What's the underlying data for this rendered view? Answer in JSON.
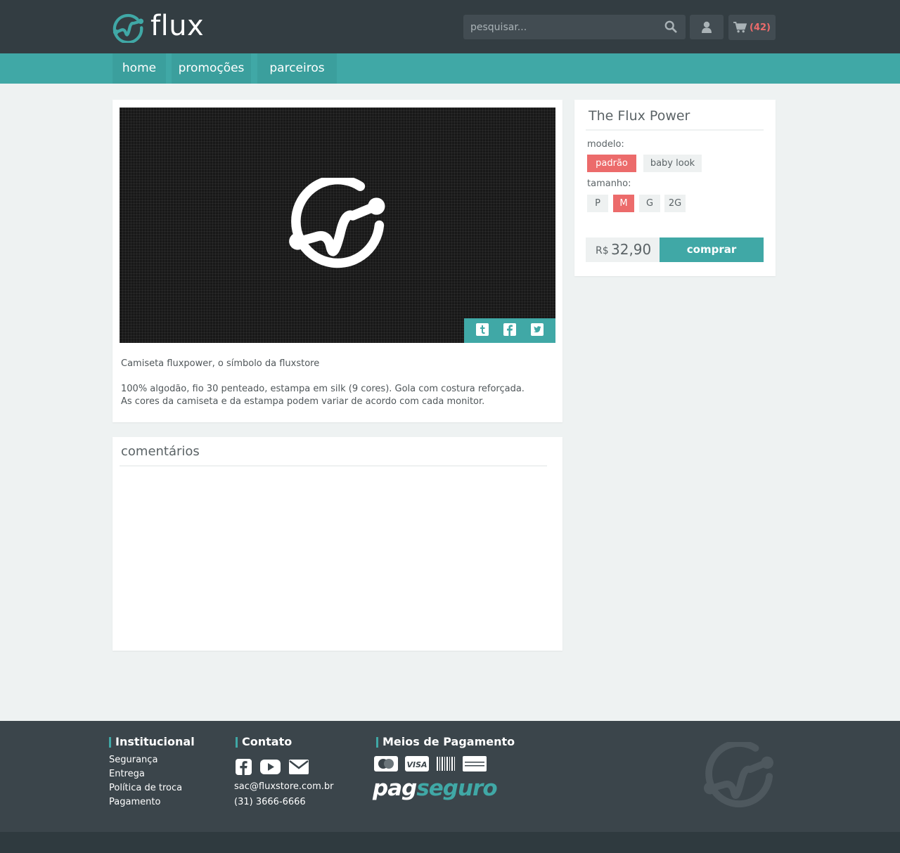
{
  "brand": {
    "name": "flux",
    "accent_color": "#40a8a6",
    "header_color": "#333d42",
    "highlight_color": "#ec6b6b"
  },
  "header": {
    "search": {
      "placeholder": "pesquisar...",
      "value": ""
    },
    "cart": {
      "count": "(42)"
    }
  },
  "nav": {
    "items": [
      {
        "label": "home"
      },
      {
        "label": "promoções"
      },
      {
        "label": "parceiros"
      }
    ]
  },
  "product": {
    "title": "The Flux Power",
    "model_label": "modelo:",
    "models": [
      {
        "label": "padrão",
        "selected": true
      },
      {
        "label": "baby look",
        "selected": false
      }
    ],
    "size_label": "tamanho:",
    "sizes": [
      {
        "label": "P",
        "selected": false
      },
      {
        "label": "M",
        "selected": true
      },
      {
        "label": "G",
        "selected": false
      },
      {
        "label": "2G",
        "selected": false
      }
    ],
    "currency": "R$",
    "price": "32,90",
    "buy_label": "comprar",
    "description": {
      "line1": "Camiseta fluxpower, o símbolo da fluxstore",
      "line2": "100% algodão, fio 30 penteado, estampa em silk (9 cores). Gola com costura reforçada.",
      "line3": "As cores da camiseta e da estampa podem variar de acordo com cada monitor."
    },
    "share_icons": [
      "tumblr-icon",
      "facebook-icon",
      "twitter-icon"
    ]
  },
  "comments": {
    "title": "comentários"
  },
  "footer": {
    "institucional": {
      "title": "Institucional",
      "links": [
        "Segurança",
        "Entrega",
        "Política de troca",
        "Pagamento"
      ]
    },
    "contato": {
      "title": "Contato",
      "social_icons": [
        "facebook-icon",
        "youtube-icon",
        "mail-icon"
      ],
      "email": "sac@fluxstore.com.br",
      "phone": "(31) 3666-6666"
    },
    "pagamento": {
      "title": "Meios de Pagamento",
      "card_icons": [
        "mastercard-icon",
        "visa-icon",
        "boleto-barcode-icon",
        "american-express-icon"
      ],
      "visa_text": "VISA",
      "pag": "pag",
      "seguro": "seguro"
    }
  }
}
